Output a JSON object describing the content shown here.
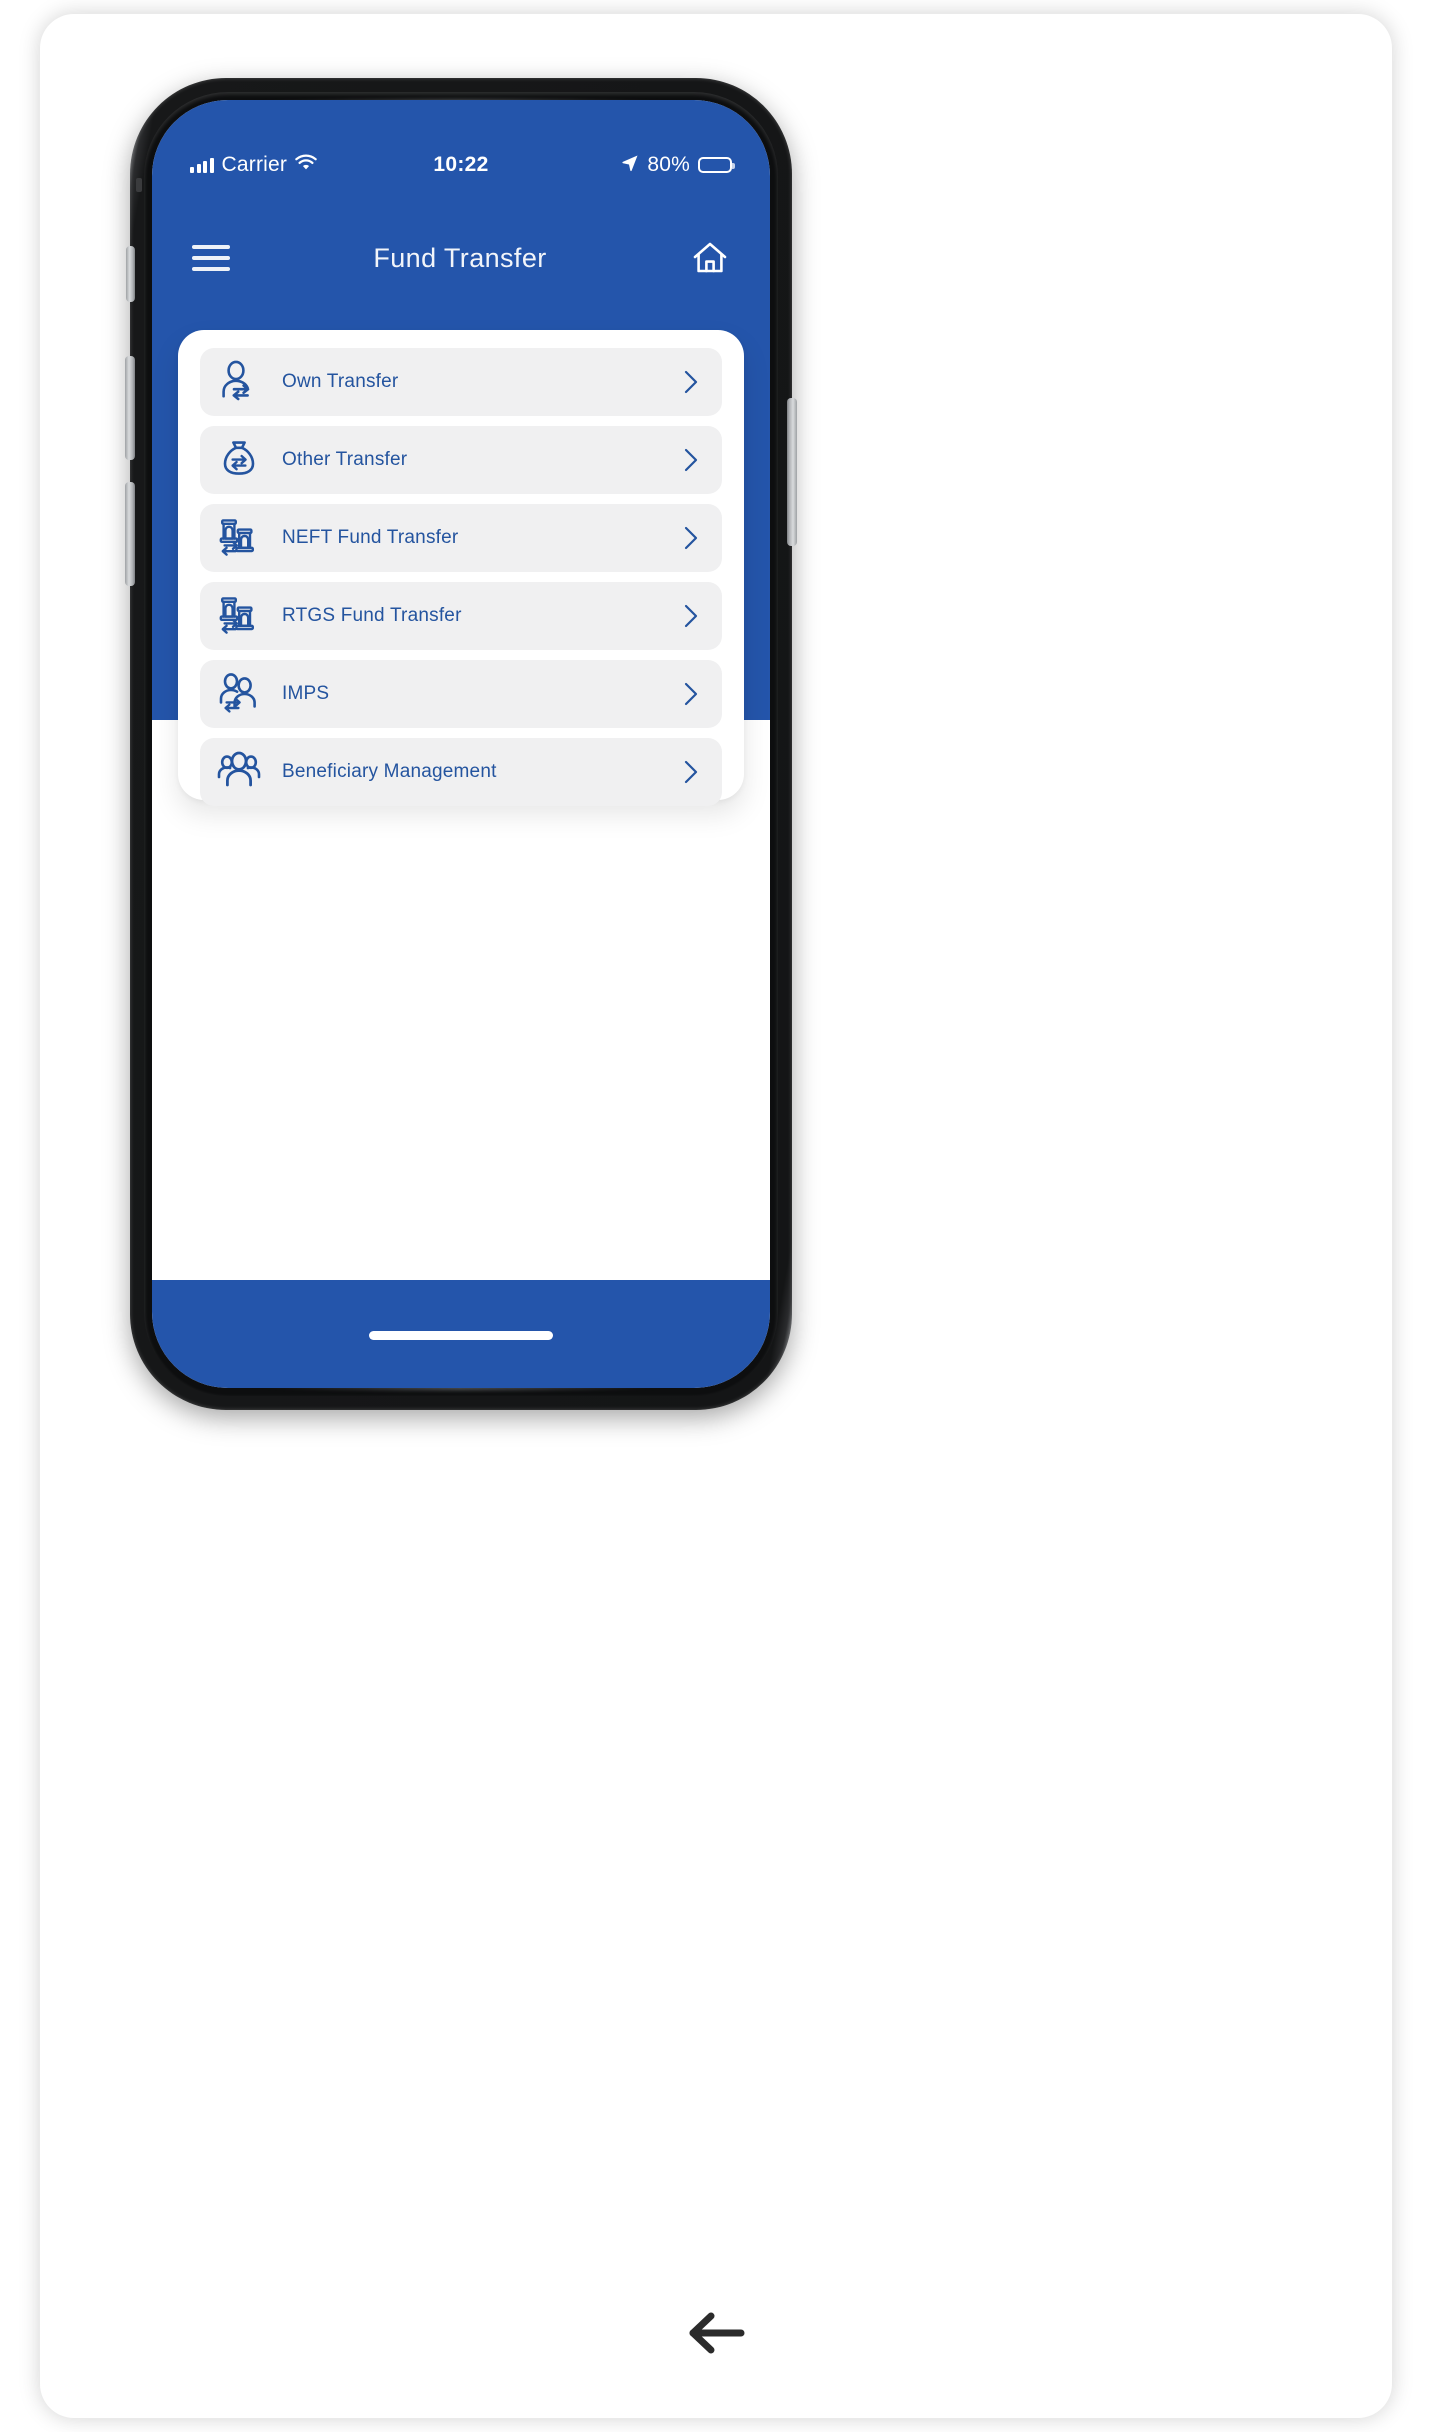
{
  "device": {
    "frame": "iphone-frame",
    "buttons": [
      "silence-switch",
      "volume-up",
      "volume-down",
      "power"
    ]
  },
  "colors": {
    "brand_blue": "#2455ab",
    "icon_blue": "#24549f",
    "row_bg": "#f0f0f1",
    "card_bg": "#ffffff",
    "status_text": "#ffffff"
  },
  "status_bar": {
    "carrier": "Carrier",
    "time": "10:22",
    "battery_percent": "80%",
    "icons": {
      "signal": "signal-bars-icon",
      "wifi": "wifi-icon",
      "location": "location-arrow-icon",
      "battery": "battery-icon"
    }
  },
  "app_bar": {
    "menu_icon": "hamburger-menu-icon",
    "title": "Fund Transfer",
    "home_icon": "home-icon"
  },
  "menu": {
    "items": [
      {
        "label": "Own Transfer",
        "icon": "person-transfer-icon",
        "chevron": "chevron-right-icon"
      },
      {
        "label": "Other Transfer",
        "icon": "money-bag-transfer-icon",
        "chevron": "chevron-right-icon"
      },
      {
        "label": "NEFT Fund Transfer",
        "icon": "bank-transfer-icon",
        "chevron": "chevron-right-icon"
      },
      {
        "label": "RTGS Fund Transfer",
        "icon": "bank-transfer-icon",
        "chevron": "chevron-right-icon"
      },
      {
        "label": "IMPS",
        "icon": "two-people-transfer-icon",
        "chevron": "chevron-right-icon"
      },
      {
        "label": "Beneficiary Management",
        "icon": "people-group-icon",
        "chevron": "chevron-right-icon"
      }
    ]
  },
  "bottom": {
    "home_indicator": "home-indicator",
    "back_icon": "back-arrow-icon"
  }
}
